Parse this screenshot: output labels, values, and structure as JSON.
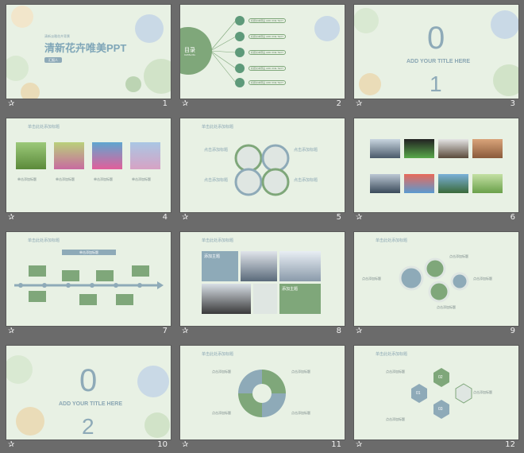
{
  "slides": [
    {
      "num": "1",
      "title_cn": "清新花卉唯美PPT",
      "subtitle": "清新淡雅花卉背景",
      "button": "汇报人"
    },
    {
      "num": "2",
      "menu_title": "目录",
      "menu_sub": "CATALOG",
      "items": [
        "标题文本预设 ADD ONE TEXT",
        "标题文本预设 ADD ONE TEXT",
        "标题文本预设 ADD ONE TEXT",
        "标题文本预设 ADD ONE TEXT",
        "标题文本预设 ADD ONE TEXT"
      ]
    },
    {
      "num": "3",
      "digit_top": "0",
      "digit_bottom": "1",
      "title": "ADD YOUR TITLE HERE"
    },
    {
      "num": "4",
      "header": "单击此处添加标题",
      "captions": [
        "单击添加标题",
        "单击添加标题",
        "单击添加标题",
        "单击添加标题"
      ]
    },
    {
      "num": "5",
      "header": "单击此处添加标题",
      "labels": [
        "点击添加标题",
        "点击添加标题",
        "点击添加标题",
        "点击添加标题"
      ]
    },
    {
      "num": "6",
      "header": "单击此处添加标题"
    },
    {
      "num": "7",
      "header": "单击此处添加标题",
      "top_label": "单击添加标题"
    },
    {
      "num": "8",
      "header": "单击此处添加标题",
      "box1": "添加主题",
      "box2": "添加主题"
    },
    {
      "num": "9",
      "header": "单击此处添加标题",
      "labels": [
        "点击添加标题",
        "点击添加标题",
        "点击添加标题",
        "点击添加标题"
      ]
    },
    {
      "num": "10",
      "digit_top": "0",
      "digit_bottom": "2",
      "title": "ADD YOUR TITLE HERE"
    },
    {
      "num": "11",
      "header": "单击此处添加标题",
      "labels": [
        "点击添加标题",
        "点击添加标题",
        "点击添加标题",
        "点击添加标题"
      ]
    },
    {
      "num": "12",
      "header": "单击此处添加标题",
      "hex_labels": [
        "01",
        "02",
        "03"
      ],
      "labels": [
        "点击添加标题",
        "点击添加标题",
        "点击添加标题"
      ]
    }
  ],
  "colors": {
    "bg": "#6b6b6b",
    "slide": "#e8f1e4",
    "green": "#7fa77a",
    "blue": "#8eaab8"
  }
}
